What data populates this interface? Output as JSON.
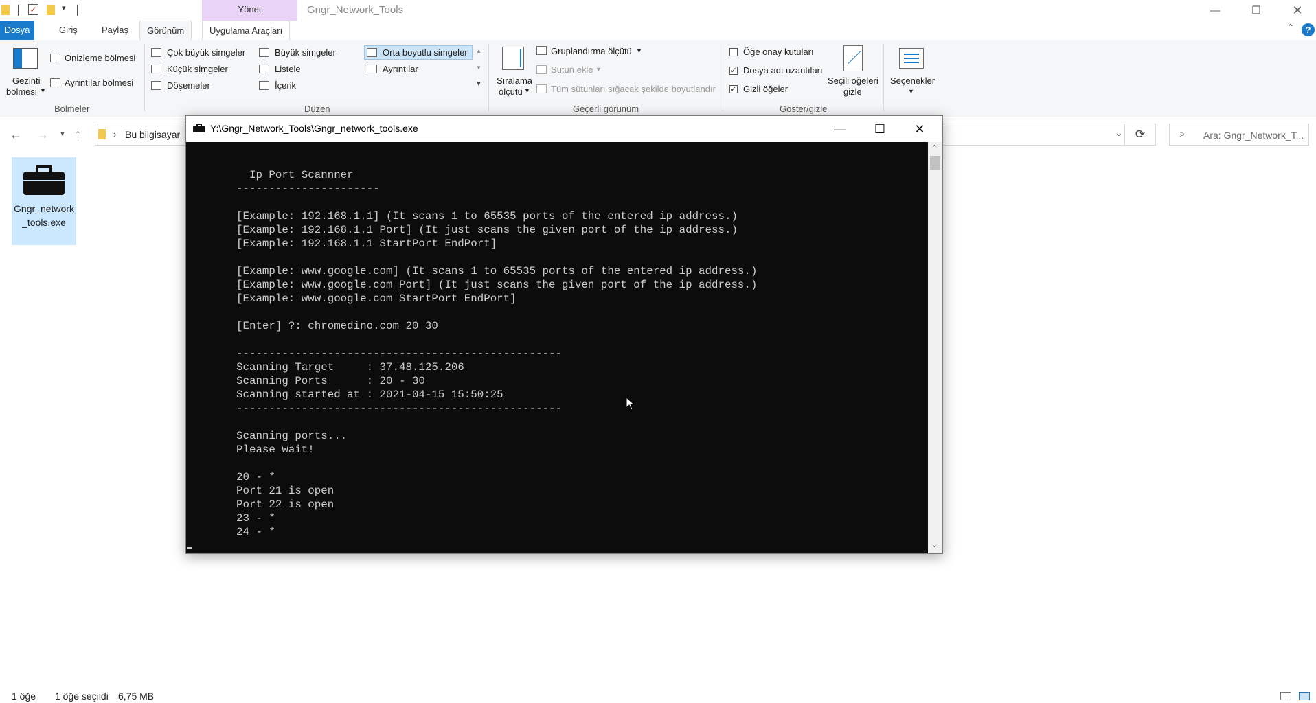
{
  "window": {
    "title": "Gngr_Network_Tools",
    "contextual_tab_group": "Yönet"
  },
  "tabs": [
    {
      "label": "Dosya"
    },
    {
      "label": "Giriş"
    },
    {
      "label": "Paylaş"
    },
    {
      "label": "Görünüm"
    },
    {
      "label": "Uygulama Araçları"
    }
  ],
  "ribbon": {
    "panes": {
      "nav_pane_line1": "Gezinti",
      "nav_pane_line2": "bölmesi",
      "preview_pane": "Önizleme bölmesi",
      "details_pane": "Ayrıntılar bölmesi",
      "group_label": "Bölmeler"
    },
    "layout": {
      "extra_large": "Çok büyük simgeler",
      "large": "Büyük simgeler",
      "medium": "Orta boyutlu simgeler",
      "small": "Küçük simgeler",
      "list": "Listele",
      "details": "Ayrıntılar",
      "tiles": "Döşemeler",
      "content": "İçerik",
      "group_label": "Düzen"
    },
    "current_view": {
      "sort_line1": "Sıralama",
      "sort_line2": "ölçütü",
      "group_by": "Gruplandırma ölçütü",
      "add_columns": "Sütun ekle",
      "size_columns": "Tüm sütunları sığacak şekilde boyutlandır",
      "group_label": "Geçerli görünüm"
    },
    "show_hide": {
      "item_checkboxes": "Öğe onay kutuları",
      "item_checkboxes_checked": false,
      "extensions": "Dosya adı uzantıları",
      "extensions_checked": true,
      "hidden_items": "Gizli öğeler",
      "hidden_items_checked": true,
      "hide_selected_line1": "Seçili öğeleri",
      "hide_selected_line2": "gizle",
      "group_label": "Göster/gizle"
    },
    "options": "Seçenekler"
  },
  "address": {
    "crumb": "Bu bilgisayar",
    "search_placeholder": "Ara: Gngr_Network_T..."
  },
  "file": {
    "name": "Gngr_network_tools.exe"
  },
  "status": {
    "count": "1 öğe",
    "selected": "1 öğe seçildi",
    "size": "6,75 MB"
  },
  "console": {
    "title": "Y:\\Gngr_Network_Tools\\Gngr_network_tools.exe",
    "lines": [
      "  Ip Port Scannner",
      "----------------------",
      "",
      "[Example: 192.168.1.1] (It scans 1 to 65535 ports of the entered ip address.)",
      "[Example: 192.168.1.1 Port] (It just scans the given port of the ip address.)",
      "[Example: 192.168.1.1 StartPort EndPort]",
      "",
      "[Example: www.google.com] (It scans 1 to 65535 ports of the entered ip address.)",
      "[Example: www.google.com Port] (It just scans the given port of the ip address.)",
      "[Example: www.google.com StartPort EndPort]",
      "",
      "[Enter] ?: chromedino.com 20 30",
      "",
      "--------------------------------------------------",
      "Scanning Target     : 37.48.125.206",
      "Scanning Ports      : 20 - 30",
      "Scanning started at : 2021-04-15 15:50:25",
      "--------------------------------------------------",
      "",
      "Scanning ports...",
      "Please wait!",
      "",
      "20 - *",
      "Port 21 is open",
      "Port 22 is open",
      "23 - *",
      "24 - *"
    ]
  }
}
